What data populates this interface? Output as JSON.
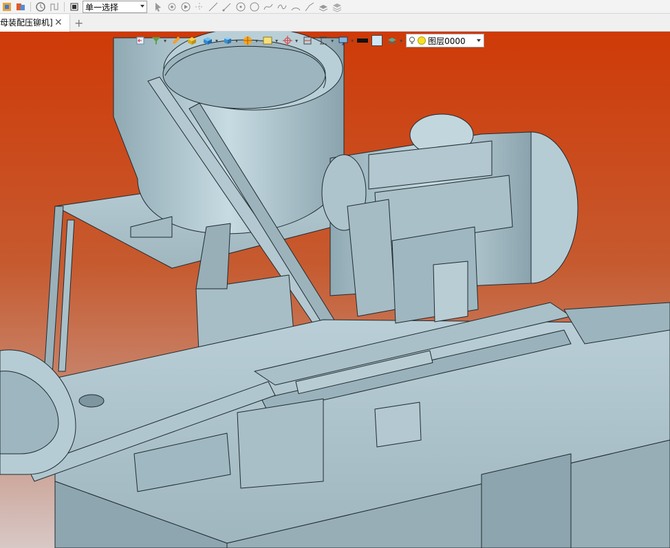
{
  "toolbar": {
    "selection_mode": "单一选择",
    "icons": [
      "app-icon",
      "assembly-icon",
      "part-icon",
      "clock-icon",
      "path-icon",
      "stop-icon",
      "pointer-icon",
      "rotate-icon",
      "play-icon",
      "point-icon",
      "line-icon",
      "segment-icon",
      "circle-point-icon",
      "circle-icon",
      "spline-icon",
      "curve-icon",
      "arc-icon",
      "polyline-icon",
      "stack-icon",
      "layers-icon"
    ]
  },
  "tabs": {
    "active_label": "母装配压铆机]",
    "close_symbol": "✕",
    "add_symbol": "+"
  },
  "view_toolbar": {
    "layer_name": "图层0000"
  },
  "colors": {
    "background_top": "#cf3a08",
    "background_bottom": "#d8c8c6",
    "model_fill": "#a9c2cc",
    "model_edge": "#1e2a30"
  }
}
